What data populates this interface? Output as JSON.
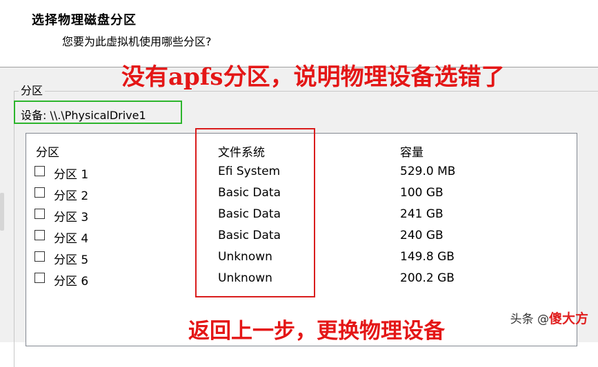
{
  "header": {
    "title": "选择物理磁盘分区",
    "subtitle": "您要为此虚拟机使用哪些分区?"
  },
  "group": {
    "label": "分区",
    "device_label": "设备: \\\\.\\PhysicalDrive1"
  },
  "table": {
    "columns": [
      "分区",
      "文件系统",
      "容量"
    ],
    "rows": [
      {
        "name": "分区 1",
        "fs": "Efi System",
        "size": "529.0 MB",
        "checked": false
      },
      {
        "name": "分区 2",
        "fs": "Basic Data",
        "size": "100 GB",
        "checked": false
      },
      {
        "name": "分区 3",
        "fs": "Basic Data",
        "size": "241 GB",
        "checked": false
      },
      {
        "name": "分区 4",
        "fs": "Basic Data",
        "size": "240 GB",
        "checked": false
      },
      {
        "name": "分区 5",
        "fs": "Unknown",
        "size": "149.8 GB",
        "checked": false
      },
      {
        "name": "分区 6",
        "fs": "Unknown",
        "size": "200.2 GB",
        "checked": false
      }
    ]
  },
  "annotations": {
    "top": "没有apfs分区，说明物理设备选错了",
    "bottom": "返回上一步，更换物理设备"
  },
  "watermark": {
    "text": "头条 @",
    "logo_text": "傻大方"
  },
  "colors": {
    "annotation_red": "#e41616",
    "device_box_green": "#2cb52c",
    "highlight_box_red": "#d91c1c"
  }
}
